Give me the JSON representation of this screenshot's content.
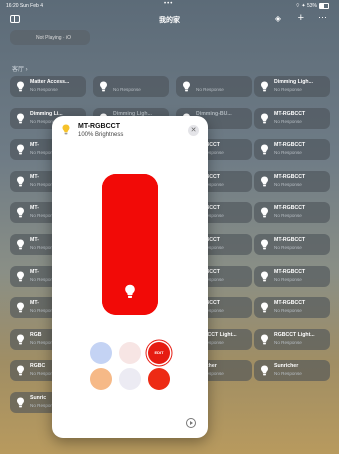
{
  "status_bar": {
    "time": "16:20 Sun Feb 4",
    "dots": "•••",
    "system": "⌔ ✦ 53%"
  },
  "nav": {
    "title": "我的家"
  },
  "now_playing": {
    "status": "Not Playing · iO"
  },
  "room": {
    "label": "客厅 ›"
  },
  "tiles": [
    {
      "name": "Matter Access...",
      "status": "No Response",
      "faint": false
    },
    {
      "name": "",
      "status": "No Response",
      "faint": false
    },
    {
      "name": "",
      "status": "No Response",
      "faint": false
    },
    {
      "name": "Dimming Ligh...",
      "status": "No Response",
      "faint": false
    },
    {
      "name": "Dimming Li...",
      "status": "No Response",
      "faint": false
    },
    {
      "name": "Dimming Ligh...",
      "status": "",
      "faint": true
    },
    {
      "name": "Dimming-BU...",
      "status": "",
      "faint": true
    },
    {
      "name": "MT-RGBCCT",
      "status": "No Response",
      "faint": false
    },
    {
      "name": "MT-",
      "status": "No Response",
      "faint": false
    },
    {
      "name": "-RGBCCT",
      "status": "No Response",
      "faint": false
    },
    {
      "name": "MT-RGBCCT",
      "status": "No Response",
      "faint": false
    },
    {
      "name": "MT-",
      "status": "No Response",
      "faint": false
    },
    {
      "name": "-RGBCCT",
      "status": "No Response",
      "faint": false
    },
    {
      "name": "MT-RGBCCT",
      "status": "No Response",
      "faint": false
    },
    {
      "name": "MT-",
      "status": "No Response",
      "faint": false
    },
    {
      "name": "-RGBCCT",
      "status": "No Response",
      "faint": false
    },
    {
      "name": "MT-RGBCCT",
      "status": "No Response",
      "faint": false
    },
    {
      "name": "MT-",
      "status": "No Response",
      "faint": false
    },
    {
      "name": "-RGBCCT",
      "status": "No Response",
      "faint": false
    },
    {
      "name": "MT-RGBCCT",
      "status": "No Response",
      "faint": false
    },
    {
      "name": "MT-",
      "status": "No Response",
      "faint": false
    },
    {
      "name": "-RGBCCT",
      "status": "No Response",
      "faint": false
    },
    {
      "name": "MT-RGBCCT",
      "status": "No Response",
      "faint": false
    },
    {
      "name": "MT-",
      "status": "No Response",
      "faint": false
    },
    {
      "name": "-RGBCCT",
      "status": "No Response",
      "faint": false
    },
    {
      "name": "MT-RGBCCT",
      "status": "No Response",
      "faint": false
    },
    {
      "name": "RGB",
      "status": "No Response",
      "faint": false
    },
    {
      "name": "RGBCCT Light...",
      "status": "No Response",
      "faint": false
    },
    {
      "name": "RGBCCT Light...",
      "status": "No Response",
      "faint": false
    },
    {
      "name": "RGBC",
      "status": "No Response",
      "faint": false
    },
    {
      "name": "unricher",
      "status": "No Response",
      "faint": false
    },
    {
      "name": "Sunricher",
      "status": "No Response",
      "faint": false
    },
    {
      "name": "Sunric",
      "status": "No Response",
      "faint": false
    }
  ],
  "modal": {
    "name": "MT-RGBCCT",
    "brightness": "100% Brightness",
    "brightness_level": 100,
    "slider_color": "#f20a07",
    "swatches": [
      {
        "color": "#c4d3f4",
        "label": ""
      },
      {
        "color": "#f7e5e4",
        "label": ""
      },
      {
        "color": "#e61c12",
        "label": "EDIT",
        "selected": true
      },
      {
        "color": "#f6b987",
        "label": ""
      },
      {
        "color": "#ecebf3",
        "label": ""
      },
      {
        "color": "#ed2b14",
        "label": ""
      }
    ],
    "close_symbol": "✕"
  },
  "icons": {
    "bulb": "lightbulb-icon",
    "close": "close-icon",
    "settings": "accessory-settings-icon",
    "sidebar": "sidebar-toggle-icon",
    "add": "plus-icon",
    "more": "more-icon"
  }
}
